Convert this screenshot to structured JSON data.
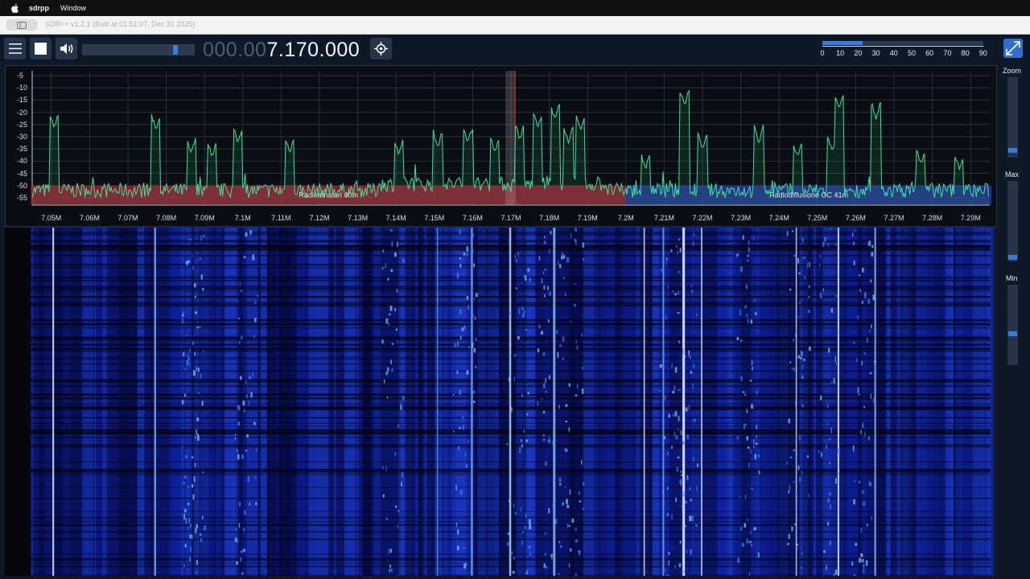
{
  "menubar": {
    "apple_icon": "apple-logo-icon",
    "app_name": "sdrpp",
    "menu_window": "Window"
  },
  "window": {
    "title": "SDR++ v1.2.1 (Built at 01:51:07, Dec 31 2025)"
  },
  "toolbar": {
    "menu_icon": "hamburger-menu-icon",
    "stop_icon": "stop-square-icon",
    "volume_icon": "speaker-volume-icon",
    "volume_level": 0.84,
    "frequency_dim": "000.00",
    "frequency_lit": "7.170.000",
    "tune_icon": "crosshair-target-icon",
    "snr_level": 0.25,
    "snr_scale": [
      "0",
      "10",
      "20",
      "30",
      "40",
      "50",
      "60",
      "70",
      "80",
      "90"
    ],
    "collapse_icon": "collapse-expand-icon"
  },
  "fft": {
    "y_labels": [
      "-5",
      "-10",
      "-15",
      "-20",
      "-25",
      "-30",
      "-35",
      "-40",
      "-45",
      "-50",
      "-55"
    ],
    "x_labels": [
      "7.05M",
      "7.06M",
      "7.07M",
      "7.08M",
      "7.09M",
      "7.1M",
      "7.11M",
      "7.12M",
      "7.13M",
      "7.14M",
      "7.15M",
      "7.16M",
      "7.17M",
      "7.18M",
      "7.19M",
      "7.2M",
      "7.21M",
      "7.22M",
      "7.23M",
      "7.24M",
      "7.25M",
      "7.26M",
      "7.27M",
      "7.28M",
      "7.29M"
    ],
    "bands": [
      {
        "name": "Radioamatori 40m",
        "color": "#b41c32"
      },
      {
        "name": "Radiodiffusione OC 41m",
        "color": "#2c37a8"
      }
    ],
    "trace_color": "#3fe09a",
    "vfo_center_mhz": 7.17
  },
  "sliders": {
    "zoom_label": "Zoom",
    "zoom_level": 0.05,
    "max_label": "Max",
    "max_level": 0.0,
    "min_label": "Min",
    "min_level": 0.38
  }
}
